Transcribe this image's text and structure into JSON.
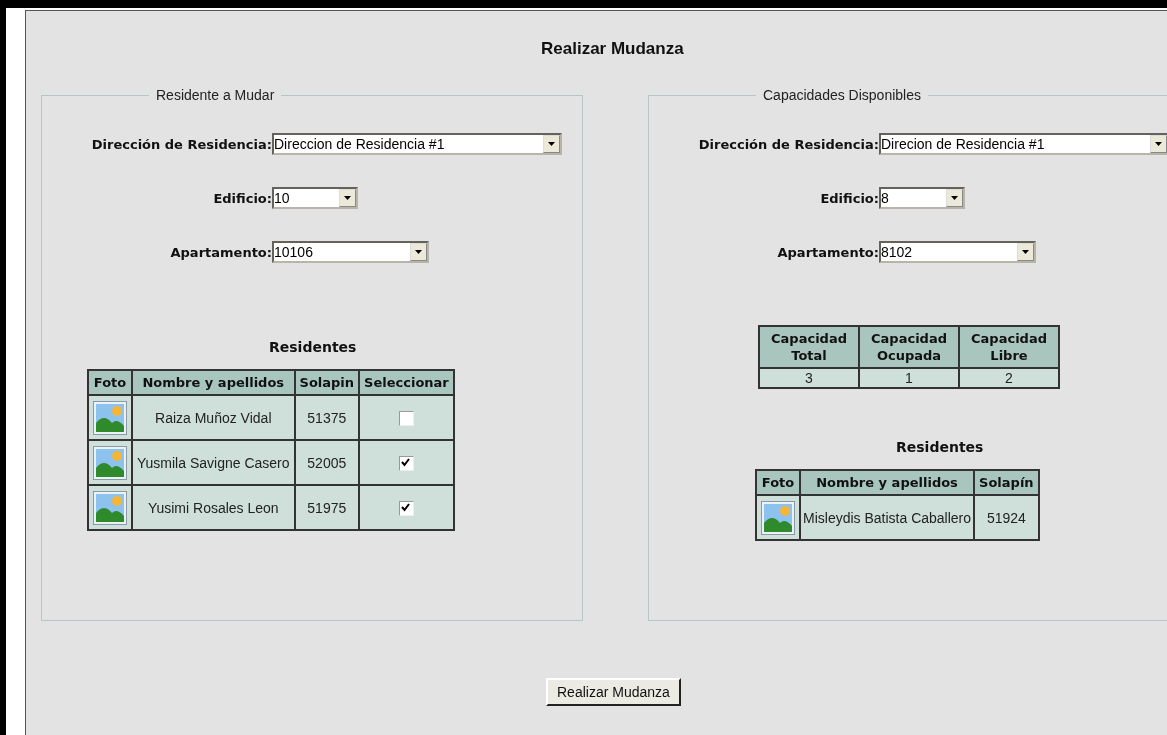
{
  "title": "Realizar Mudanza",
  "resident_to_move": {
    "legend": "Residente a Mudar",
    "fields": [
      {
        "label": "Dirección de Residencia:",
        "value": "Direccion de Residencia #1"
      },
      {
        "label": "Edificio:",
        "value": "10"
      },
      {
        "label": "Apartamento:",
        "value": "10106"
      }
    ],
    "residents_heading": "Residentes",
    "columns": [
      "Foto",
      "Nombre y apellidos",
      "Solapin",
      "Seleccionar"
    ],
    "rows": [
      {
        "name": "Raiza Muñoz Vidal",
        "badge": "51375",
        "checked": false
      },
      {
        "name": "Yusmila Savigne Casero",
        "badge": "52005",
        "checked": true
      },
      {
        "name": "Yusimi Rosales Leon",
        "badge": "51975",
        "checked": true
      }
    ]
  },
  "available_capacities": {
    "legend": "Capacidades Disponibles",
    "fields": [
      {
        "label": "Dirección de Residencia:",
        "value": "Direcion de Residencia #1"
      },
      {
        "label": "Edificio:",
        "value": "8"
      },
      {
        "label": "Apartamento:",
        "value": "8102"
      }
    ],
    "capacity_columns": [
      "Capacidad Total",
      "Capacidad Ocupada",
      "Capacidad Libre"
    ],
    "capacity_values": [
      "3",
      "1",
      "2"
    ],
    "residents_heading": "Residentes",
    "columns": [
      "Foto",
      "Nombre y apellidos",
      "Solapín"
    ],
    "rows": [
      {
        "name": "Misleydis Batista Caballero",
        "badge": "51924"
      }
    ]
  },
  "button": "Realizar Mudanza"
}
